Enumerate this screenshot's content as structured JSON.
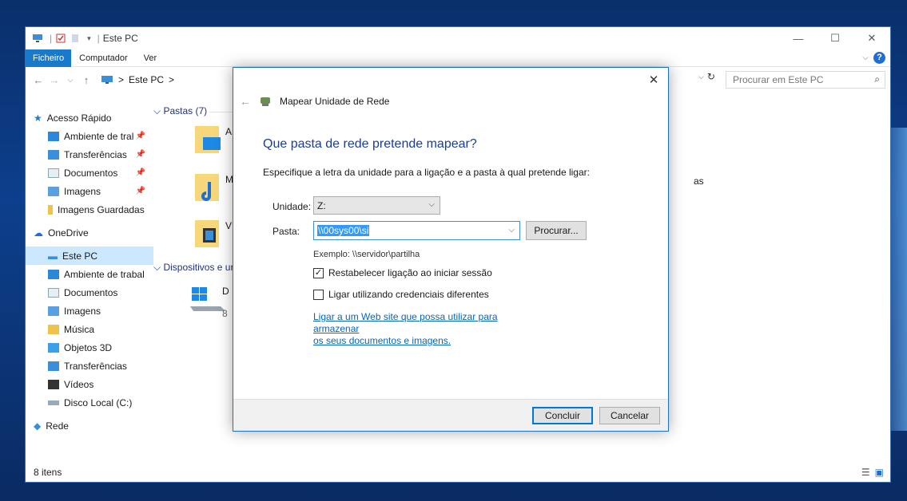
{
  "explorer": {
    "title": "Este PC",
    "ribbon_tabs": [
      "Ficheiro",
      "Computador",
      "Ver"
    ],
    "help": "?",
    "address": {
      "path_sep": ">",
      "path": "Este PC",
      "trail": ">"
    },
    "search_placeholder": "Procurar em Este PC",
    "nav": {
      "quick_access": "Acesso Rápido",
      "quick_items": [
        "Ambiente de tral",
        "Transferências",
        "Documentos",
        "Imagens",
        "Imagens Guardadas"
      ],
      "onedrive": "OneDrive",
      "this_pc": "Este PC",
      "pc_items": [
        "Ambiente de trabal",
        "Documentos",
        "Imagens",
        "Música",
        "Objetos 3D",
        "Transferências",
        "Vídeos",
        "Disco Local (C:)"
      ],
      "network": "Rede"
    },
    "groups": {
      "folders": "Pastas (7)",
      "devices": "Dispositivos e un"
    },
    "tiles": {
      "t1": "A",
      "t2": "M",
      "t3": "V",
      "t4": "D",
      "t5": "8",
      "right_text": "as"
    },
    "status": "8 itens"
  },
  "dialog": {
    "title": "Mapear Unidade de Rede",
    "heading": "Que pasta de rede pretende mapear?",
    "instruction": "Especifique a letra da unidade para a ligação e a pasta à qual pretende ligar:",
    "drive_label": "Unidade:",
    "drive_value": "Z:",
    "folder_label": "Pasta:",
    "folder_value": "\\\\00sys00\\si",
    "browse": "Procurar...",
    "example": "Exemplo: \\\\servidor\\partilha",
    "reconnect": "Restabelecer ligação ao iniciar sessão",
    "reconnect_checked": true,
    "other_creds": "Ligar utilizando credenciais diferentes",
    "other_creds_checked": false,
    "link_line1": "Ligar a um Web site que possa utilizar para armazenar",
    "link_line2": "os seus documentos e imagens.",
    "finish": "Concluir",
    "cancel": "Cancelar"
  },
  "colors": {
    "accent": "#1979ca",
    "heading": "#1a3d9c",
    "link": "#0066cc",
    "selected": "#cce8ff"
  }
}
